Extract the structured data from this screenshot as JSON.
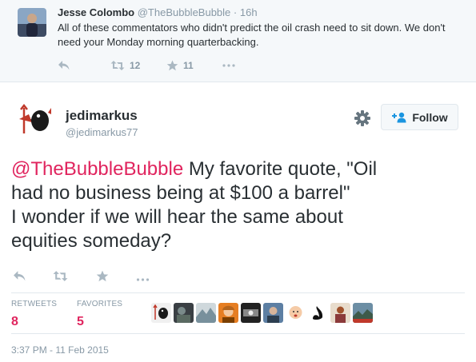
{
  "parent_tweet": {
    "author_name": "Jesse Colombo",
    "author_handle": "@TheBubbleBubble",
    "separator": "·",
    "time": "16h",
    "text": "All of these commentators who didn't predict the oil crash need to sit down. We don't need your Monday morning quarterbacking.",
    "actions": [
      {
        "name": "reply-icon",
        "count": ""
      },
      {
        "name": "retweet-icon",
        "count": "12"
      },
      {
        "name": "favorite-icon",
        "count": "11"
      },
      {
        "name": "more-icon",
        "count": ""
      }
    ]
  },
  "tweet": {
    "author_name": "jedimarkus",
    "author_handle": "@jedimarkus77",
    "follow_label": "Follow",
    "mention": "@TheBubbleBubble",
    "text_line1": " My favorite quote, \"Oil",
    "text_line2": "had no business being at $100 a barrel\"",
    "text_line3": "I wonder if we will hear the same about",
    "text_line4": "equities someday?",
    "stats": {
      "retweets_label": "RETWEETS",
      "retweets_value": "8",
      "favorites_label": "FAVORITES",
      "favorites_value": "5"
    },
    "timestamp": "3:37 PM - 11 Feb 2015"
  },
  "colors": {
    "accent": "#e0245e",
    "muted": "#8899a6",
    "text": "#292f33",
    "border": "#e1e8ed",
    "link_blue": "#1b95e0"
  },
  "icons": [
    "reply-icon",
    "retweet-icon",
    "favorite-icon",
    "more-icon",
    "gear-icon",
    "follow-person-icon"
  ]
}
